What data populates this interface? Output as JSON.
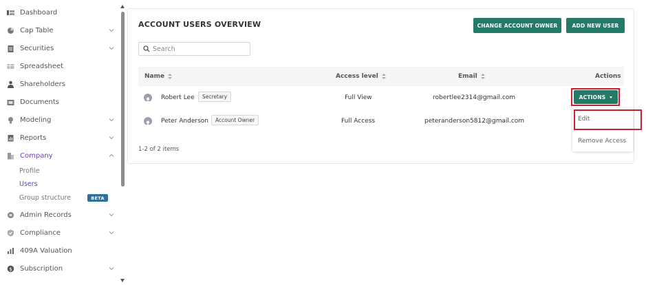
{
  "sidebar": {
    "items": [
      {
        "label": "Dashboard",
        "icon": "dashboard-icon",
        "has_chevron": false
      },
      {
        "label": "Cap Table",
        "icon": "pie-chart-icon",
        "has_chevron": true
      },
      {
        "label": "Securities",
        "icon": "clipboard-icon",
        "has_chevron": true
      },
      {
        "label": "Spreadsheet",
        "icon": "spreadsheet-icon",
        "has_chevron": false
      },
      {
        "label": "Shareholders",
        "icon": "person-icon",
        "has_chevron": false
      },
      {
        "label": "Documents",
        "icon": "folder-icon",
        "has_chevron": false
      },
      {
        "label": "Modeling",
        "icon": "bulb-icon",
        "has_chevron": true
      },
      {
        "label": "Reports",
        "icon": "report-icon",
        "has_chevron": true
      },
      {
        "label": "Company",
        "icon": "building-icon",
        "has_chevron": true,
        "expanded": true
      },
      {
        "label": "Admin Records",
        "icon": "records-icon",
        "has_chevron": true
      },
      {
        "label": "Compliance",
        "icon": "shield-check-icon",
        "has_chevron": true
      },
      {
        "label": "409A Valuation",
        "icon": "bar-chart-icon",
        "has_chevron": false
      },
      {
        "label": "Subscription",
        "icon": "dollar-icon",
        "has_chevron": true
      }
    ],
    "company_sub": [
      {
        "label": "Profile"
      },
      {
        "label": "Users"
      },
      {
        "label": "Group structure"
      }
    ],
    "beta_badge": "BETA"
  },
  "main": {
    "title": "ACCOUNT USERS OVERVIEW",
    "change_owner_label": "CHANGE ACCOUNT OWNER",
    "add_user_label": "ADD NEW USER",
    "search_placeholder": "Search",
    "table": {
      "columns": [
        "Name",
        "Access level",
        "Email",
        "Actions"
      ],
      "rows": [
        {
          "name": "Robert Lee",
          "role": "Secretary",
          "access": "Full View",
          "email": "robertlee2314@gmail.com"
        },
        {
          "name": "Peter Anderson",
          "role": "Account Owner",
          "access": "Full Access",
          "email": "peteranderson5812@gmail.com"
        }
      ]
    },
    "actions_label": "ACTIONS",
    "pagination": "1-2 of 2 items",
    "dropdown": [
      "Edit",
      "Remove Access"
    ]
  },
  "colors": {
    "accent": "#237a66",
    "active_nav": "#6a3fb5",
    "highlight": "#c8202f",
    "beta": "#2e6f9e"
  }
}
